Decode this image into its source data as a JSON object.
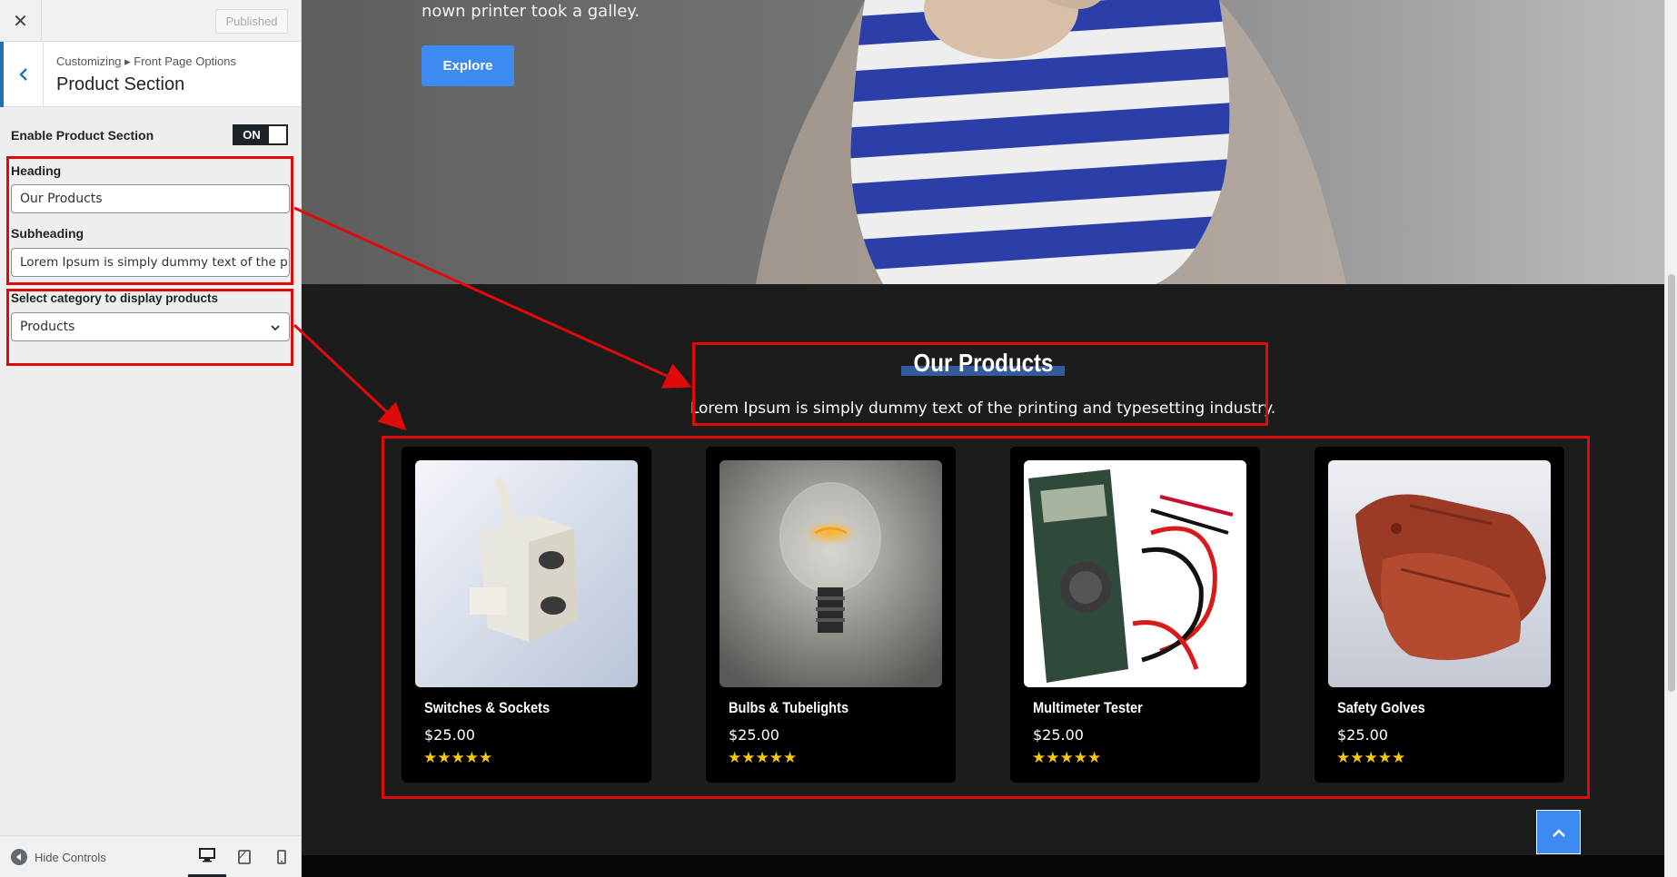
{
  "sidebar": {
    "close_glyph": "✕",
    "published_label": "Published",
    "breadcrumb": "Customizing ▸ Front Page Options",
    "section_title": "Product Section",
    "enable_label": "Enable Product Section",
    "toggle_label": "ON",
    "heading_label": "Heading",
    "heading_value": "Our Products",
    "subheading_label": "Subheading",
    "subheading_value": "Lorem Ipsum is simply dummy text of the print",
    "category_label": "Select category to display products",
    "category_value": "Products",
    "hide_controls_label": "Hide Controls"
  },
  "preview": {
    "hero_text": "nown printer took a galley.",
    "explore_label": "Explore",
    "section_heading": "Our Products",
    "section_subheading": "Lorem Ipsum is simply dummy text of the printing and typesetting industry.",
    "products": [
      {
        "name": "Switches & Sockets",
        "price": "$25.00",
        "rating": 5,
        "stars": "★★★★★"
      },
      {
        "name": "Bulbs & Tubelights",
        "price": "$25.00",
        "rating": 5,
        "stars": "★★★★★"
      },
      {
        "name": "Multimeter Tester",
        "price": "$25.00",
        "rating": 5,
        "stars": "★★★★★"
      },
      {
        "name": "Safety Golves",
        "price": "$25.00",
        "rating": 5,
        "stars": "★★★★★"
      }
    ]
  },
  "colors": {
    "accent": "#3d8bf0",
    "annotation": "#e10a0a",
    "heading_underline": "#345b9e",
    "star": "#f5c518"
  }
}
